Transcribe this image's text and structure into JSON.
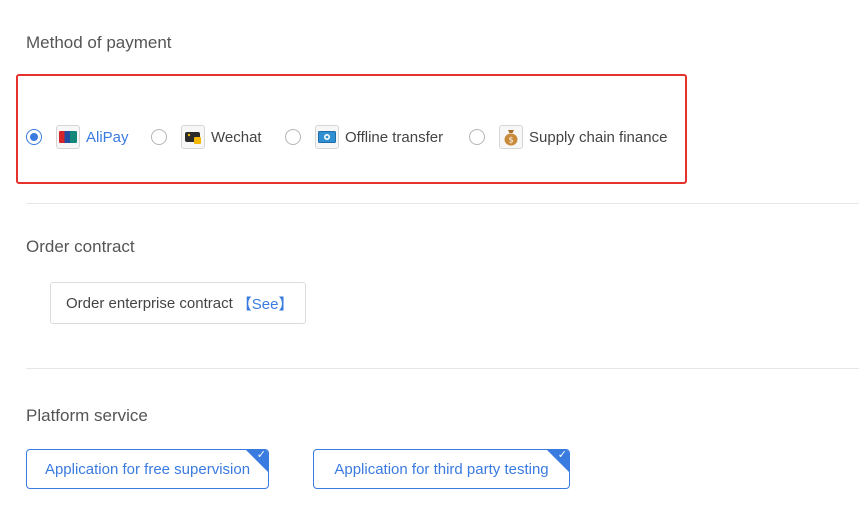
{
  "payment": {
    "title": "Method of payment",
    "options": [
      {
        "label": "AliPay",
        "icon": "unionpay-card-icon",
        "selected": true
      },
      {
        "label": "Wechat",
        "icon": "wallet-icon",
        "selected": false
      },
      {
        "label": "Offline transfer",
        "icon": "banknote-icon",
        "selected": false
      },
      {
        "label": "Supply chain finance",
        "icon": "money-bag-icon",
        "selected": false
      }
    ]
  },
  "contract": {
    "title": "Order contract",
    "text": "Order enterprise contract",
    "link": "【See】"
  },
  "service": {
    "title": "Platform service",
    "buttons": [
      {
        "label": "Application for free supervision",
        "checked": true
      },
      {
        "label": "Application for third party testing",
        "checked": true
      }
    ]
  },
  "colors": {
    "accent": "#3a7be0",
    "highlight": "#e5322d"
  }
}
